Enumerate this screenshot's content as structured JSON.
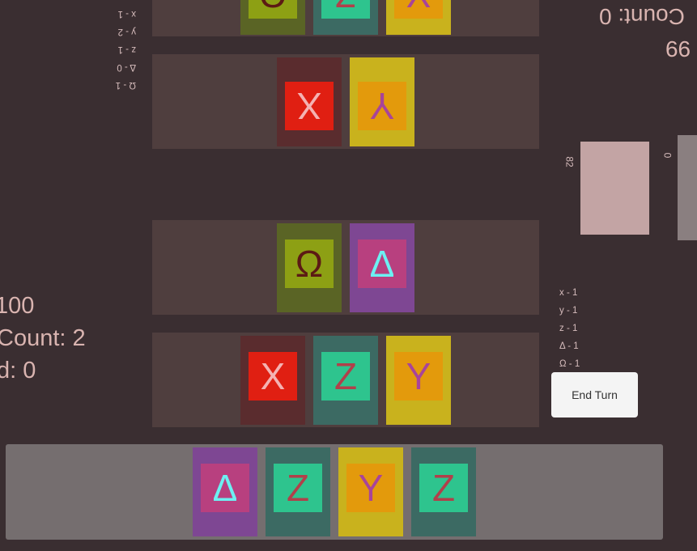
{
  "player_stats": {
    "health": "100",
    "card_count": "Count: 2",
    "discard": "d: 0"
  },
  "opponent_stats": {
    "card_count": "Count: 0",
    "health": "99"
  },
  "deck_piles": {
    "player_deck_count": "82",
    "opponent_deck_count": "0"
  },
  "player_counts": [
    "x - 1",
    "y - 1",
    "z - 1",
    "Δ - 1",
    "Ω - 1"
  ],
  "opponent_counts": [
    "Ω - 1",
    "Δ - 0",
    "z - 1",
    "y - 2",
    "x - 1"
  ],
  "lanes": {
    "opponent_back": [
      "Ω",
      "Z",
      "Y"
    ],
    "opponent_front": [
      "X",
      "Y"
    ],
    "player_front": [
      "Ω",
      "Δ"
    ],
    "player_back": [
      "X",
      "Z",
      "Y"
    ]
  },
  "hand": [
    "Δ",
    "Z",
    "Y",
    "Z"
  ],
  "controls": {
    "end_turn": "End Turn"
  }
}
